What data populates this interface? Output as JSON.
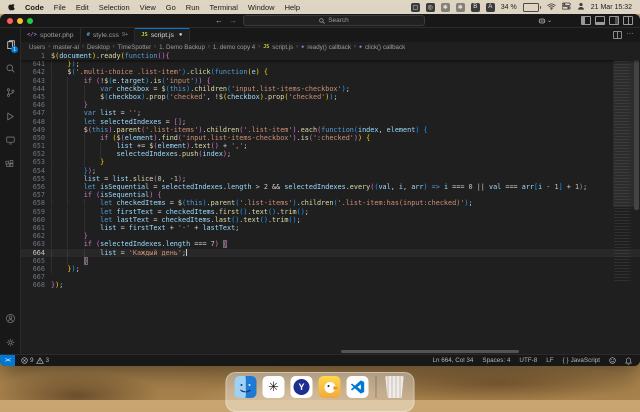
{
  "theme": {
    "accent": "#0078d4",
    "editor_bg": "#1f1f1f",
    "chrome_bg": "#181818"
  },
  "menubar": {
    "items": [
      "Code",
      "File",
      "Edit",
      "Selection",
      "View",
      "Go",
      "Run",
      "Terminal",
      "Window",
      "Help"
    ],
    "battery": "34 %",
    "clock": "21 Mar 15:32"
  },
  "titlebar": {
    "search_placeholder": "Search"
  },
  "tabbar": {
    "tabs": [
      {
        "label": "spotter.php",
        "icon": "php"
      },
      {
        "label": "style.css",
        "badge": "9+",
        "icon": "css"
      },
      {
        "label": "script.js",
        "icon": "js",
        "active": true,
        "dirty": true
      }
    ]
  },
  "breadcrumb": {
    "items": [
      {
        "label": "Users"
      },
      {
        "label": "master-al"
      },
      {
        "label": "Desktop"
      },
      {
        "label": "TimeSpotter"
      },
      {
        "label": "1. Demo Backup"
      },
      {
        "label": "1. demo copy 4"
      },
      {
        "label": "script.js",
        "icon": "js"
      },
      {
        "label": "ready() callback",
        "icon": "method"
      },
      {
        "label": "click() callback",
        "icon": "method"
      }
    ]
  },
  "editor": {
    "sticky_line": {
      "number": 1,
      "text": "$(document).ready(function(){"
    },
    "first_line_number": 641,
    "current_line": 664,
    "bracket_match_lines": [
      663,
      665
    ],
    "bracket_depth_start": 4,
    "lines": [
      "    });",
      "    $('.multi-choice .list-item').click(function(e) {",
      "        if (!$(e.target).is('input')) {",
      "            var checkbox = $(this).children('input.list-items-checkbox');",
      "            $(checkbox).prop('checked', !$(checkbox).prop('checked'));",
      "        }",
      "        var list = '';",
      "        let selectedIndexes = [];",
      "        $(this).parent('.list-items').children('.list-item').each(function(index, element) {",
      "            if ($(element).find('input.list-items-checkbox').is(':checked')) {",
      "                list += $(element).text() + ',';",
      "                selectedIndexes.push(index);",
      "            }",
      "        });",
      "        list = list.slice(0, -1);",
      "        let isSequential = selectedIndexes.length > 2 && selectedIndexes.every((val, i, arr) => i === 0 || val === arr[i - 1] + 1);",
      "        if (isSequential) {",
      "            let checkedItems = $(this).parent('.list-items').children('.list-item:has(input:checked)');",
      "            let firstText = checkedItems.first().text().trim();",
      "            let lastText = checkedItems.last().text().trim();",
      "            list = firstText + '-' + lastText;",
      "        }",
      "        if (selectedIndexes.length === 7) {",
      "            list = 'Каждый день';",
      "        }",
      "    });",
      "",
      "});"
    ]
  },
  "statusbar": {
    "errors": "9",
    "warnings": "3",
    "cursor_position": "Ln 664, Col 34",
    "indentation": "Spaces: 4",
    "encoding": "UTF-8",
    "eol": "LF",
    "language": "JavaScript"
  },
  "dock": {
    "items": [
      "Finder",
      "ChatGPT",
      "Yandex",
      "DuckDuckGo",
      "Visual Studio Code",
      "Trash"
    ]
  }
}
